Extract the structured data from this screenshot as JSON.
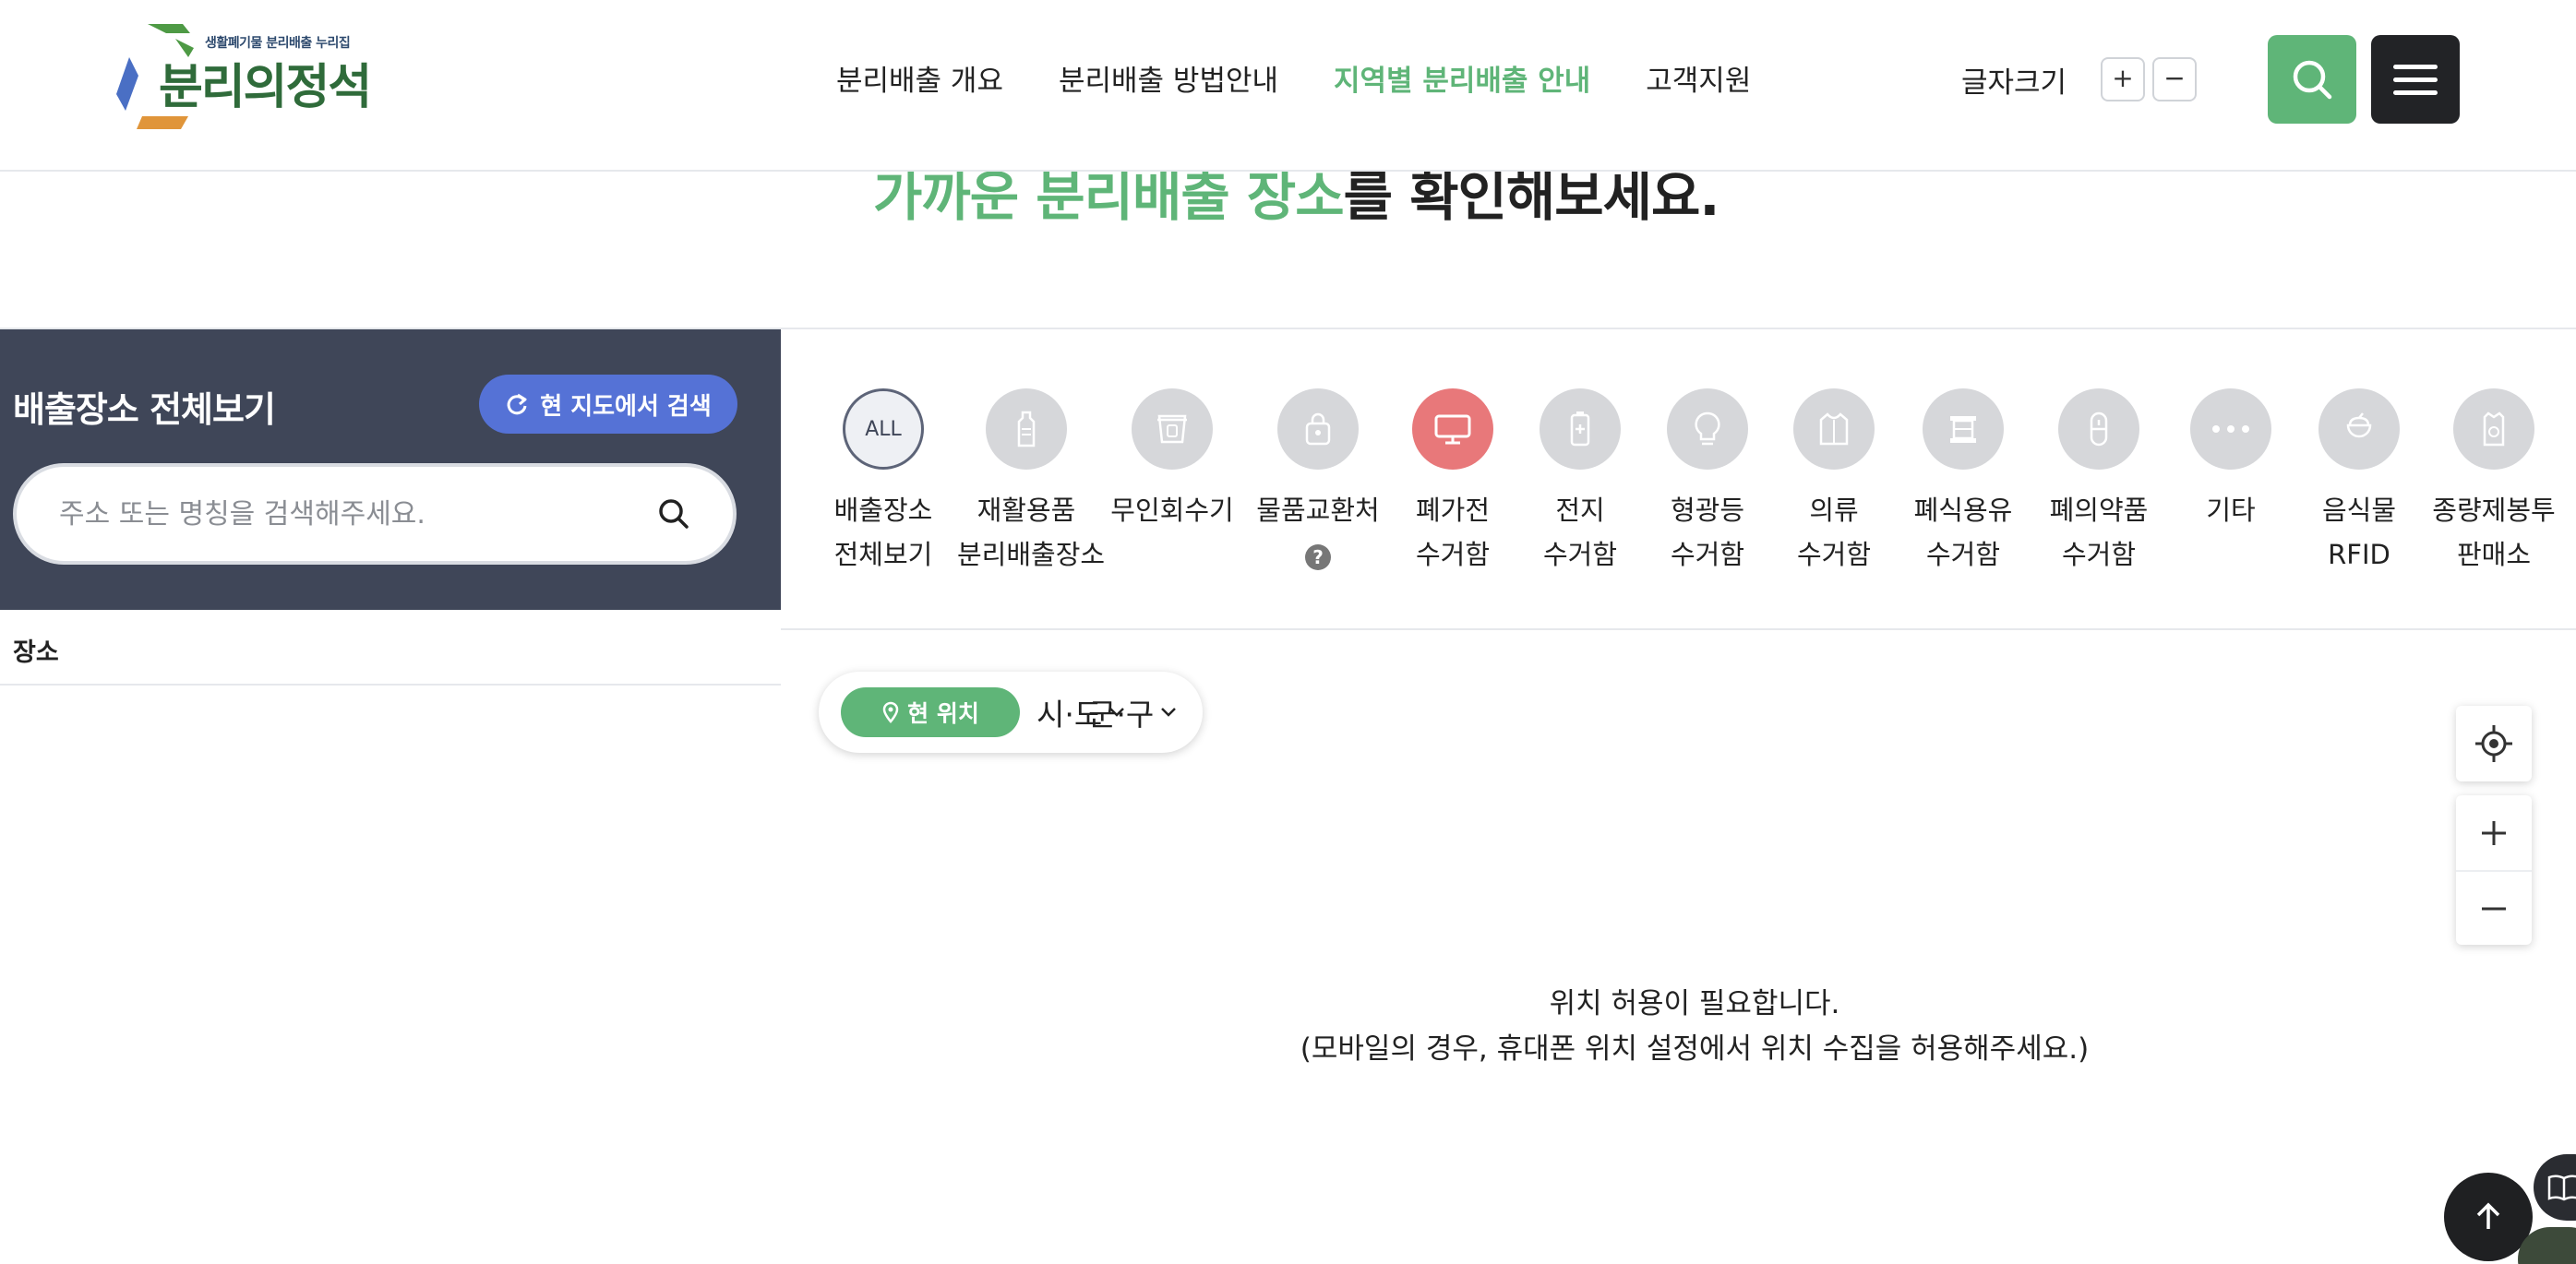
{
  "brand": {
    "tagline": "생활폐기물 분리배출 누리집",
    "name": "분리의정석"
  },
  "nav": {
    "items": [
      {
        "label": "분리배출 개요"
      },
      {
        "label": "분리배출 방법안내"
      },
      {
        "label": "지역별 분리배출 안내"
      },
      {
        "label": "고객지원"
      }
    ],
    "active_index": 2
  },
  "font_size": {
    "label": "글자크기",
    "increase": "+",
    "decrease": "−"
  },
  "headline": {
    "highlight": "가까운 분리배출 장소",
    "rest": "를 확인해보세요."
  },
  "panel": {
    "title": "배출장소 전체보기",
    "map_search_label": "현 지도에서 검색",
    "search_placeholder": "주소 또는 명칭을 검색해주세요.",
    "list_header": "장소"
  },
  "categories": [
    {
      "icon_text": "ALL",
      "line1": "배출장소",
      "line2": "전체보기",
      "icon": "all-icon"
    },
    {
      "line1": "재활용품",
      "line2": "분리배출장소",
      "icon": "bottle-icon"
    },
    {
      "line1": "무인회수기",
      "line2": "",
      "icon": "vending-machine-icon"
    },
    {
      "line1": "물품교환처",
      "help": "?",
      "icon": "shopping-bag-icon"
    },
    {
      "line1": "폐가전",
      "line2": "수거함",
      "icon": "monitor-icon",
      "selected": true
    },
    {
      "line1": "전지",
      "line2": "수거함",
      "icon": "battery-icon"
    },
    {
      "line1": "형광등",
      "line2": "수거함",
      "icon": "lightbulb-icon"
    },
    {
      "line1": "의류",
      "line2": "수거함",
      "icon": "clothing-icon"
    },
    {
      "line1": "폐식용유",
      "line2": "수거함",
      "icon": "oil-can-icon"
    },
    {
      "line1": "폐의약품",
      "line2": "수거함",
      "icon": "pill-icon"
    },
    {
      "line1": "기타",
      "line2": "",
      "icon": "more-icon"
    },
    {
      "line1": "음식물",
      "line2": "RFID",
      "icon": "food-waste-icon"
    },
    {
      "line1": "종량제봉투",
      "line2": "판매소",
      "icon": "trash-bag-icon"
    }
  ],
  "location": {
    "current_label": "현 위치",
    "province_label": "시·도",
    "district_label": "군·구"
  },
  "map_message": {
    "line1": "위치 허용이 필요합니다.",
    "line2": "(모바일의 경우, 휴대폰 위치 설정에서 위치 수집을 허용해주세요.)"
  },
  "colors": {
    "accent_green": "#5fb578",
    "panel_dark": "#3f4658",
    "map_search_blue": "#5572d6",
    "selected_red": "#e8787a"
  }
}
